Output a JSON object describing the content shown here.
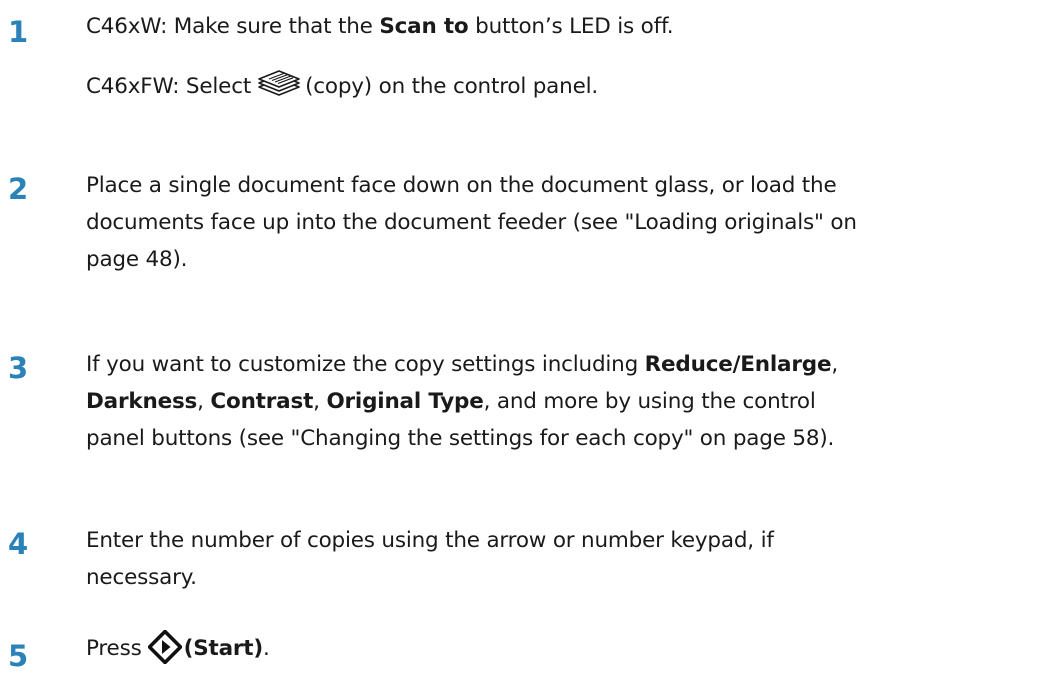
{
  "steps": [
    {
      "number": "1",
      "line1": {
        "prefix": "C46xW: Make sure that the ",
        "bold": "Scan to",
        "suffix": " button’s LED is off."
      },
      "line2": {
        "prefix": "C46xFW: Select",
        "icon": "copy-icon",
        "suffix": "(copy) on the control panel."
      }
    },
    {
      "number": "2",
      "lines": [
        "Place a single document face down on the document glass, or load the",
        "documents face up into the document feeder (see \"Loading originals\" on",
        "page 48)."
      ]
    },
    {
      "number": "3",
      "line1": {
        "prefix": "If you want to customize the copy settings including ",
        "bold": "Reduce/Enlarge",
        "suffix": ","
      },
      "line2": {
        "b1": "Darkness",
        "s1": ", ",
        "b2": "Contrast",
        "s2": ", ",
        "b3": "Original Type",
        "s3": ", and more by using the control"
      },
      "line3": "panel buttons (see \"Changing the settings for each copy\" on page 58)."
    },
    {
      "number": "4",
      "lines": [
        "Enter the number of copies using the arrow or number keypad, if",
        "necessary."
      ]
    },
    {
      "number": "5",
      "line1": {
        "prefix": "Press",
        "icon": "start-icon",
        "bold": "(Start)",
        "suffix": "."
      }
    }
  ],
  "colors": {
    "step_number": "#2a82b8",
    "text": "#1a1a1a"
  }
}
